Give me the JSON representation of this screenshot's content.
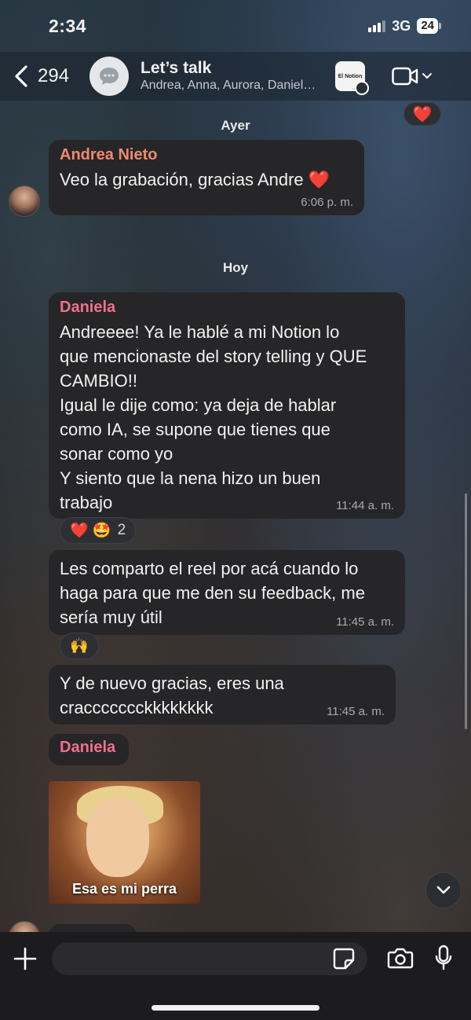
{
  "status_bar": {
    "time": "2:34",
    "network": "3G",
    "battery": "24"
  },
  "header": {
    "back_count": "294",
    "title": "Let’s talk",
    "members": "Andrea, Anna, Aurora, Daniel…",
    "app_badge_text": "El Notion"
  },
  "chat": {
    "heart_reaction": "❤️",
    "date_yesterday": "Ayer",
    "date_today": "Hoy",
    "messages": [
      {
        "sender": "Andrea Nieto",
        "sender_color": "#ef8a6f",
        "text": "Veo la grabación, gracias Andre ❤️",
        "time": "6:06 p. m."
      },
      {
        "sender": "Daniela",
        "sender_color": "#f0708e",
        "text": "Andreeee! Ya le hablé a mi Notion lo que mencionaste del story telling y QUE CAMBIO!! Igual le dije como: ya deja de hablar como IA, se supone que tienes que sonar como yo Y siento que la nena hizo un buen trabajo",
        "lines": [
          "Andreeee! Ya le hablé a mi Notion lo",
          "que mencionaste del story telling y QUE",
          "CAMBIO!!",
          "Igual le dije como: ya deja de hablar",
          "como IA, se supone que tienes que",
          "sonar como yo",
          "Y siento que la nena hizo un buen",
          "trabajo"
        ],
        "time": "11:44 a. m.",
        "reactions": "❤️ 🤩",
        "reaction_count": "2"
      },
      {
        "text": "Les comparto el reel por acá cuando lo haga para que me den su feedback, me sería muy útil",
        "lines": [
          "Les comparto el reel por acá cuando lo",
          "haga para que me den su feedback, me",
          "sería muy útil"
        ],
        "time": "11:45 a. m.",
        "reactions": "🙌"
      },
      {
        "text": "Y de nuevo gracias, eres una cracccccckkkkkkkk",
        "lines": [
          "Y de nuevo gracias, eres una",
          "craccccccckkkkkkkk"
        ],
        "time": "11:45 a. m."
      }
    ],
    "sticker_sender": "Daniela",
    "sticker_caption": "Esa es mi perra"
  },
  "input_bar": {
    "placeholder": ""
  }
}
